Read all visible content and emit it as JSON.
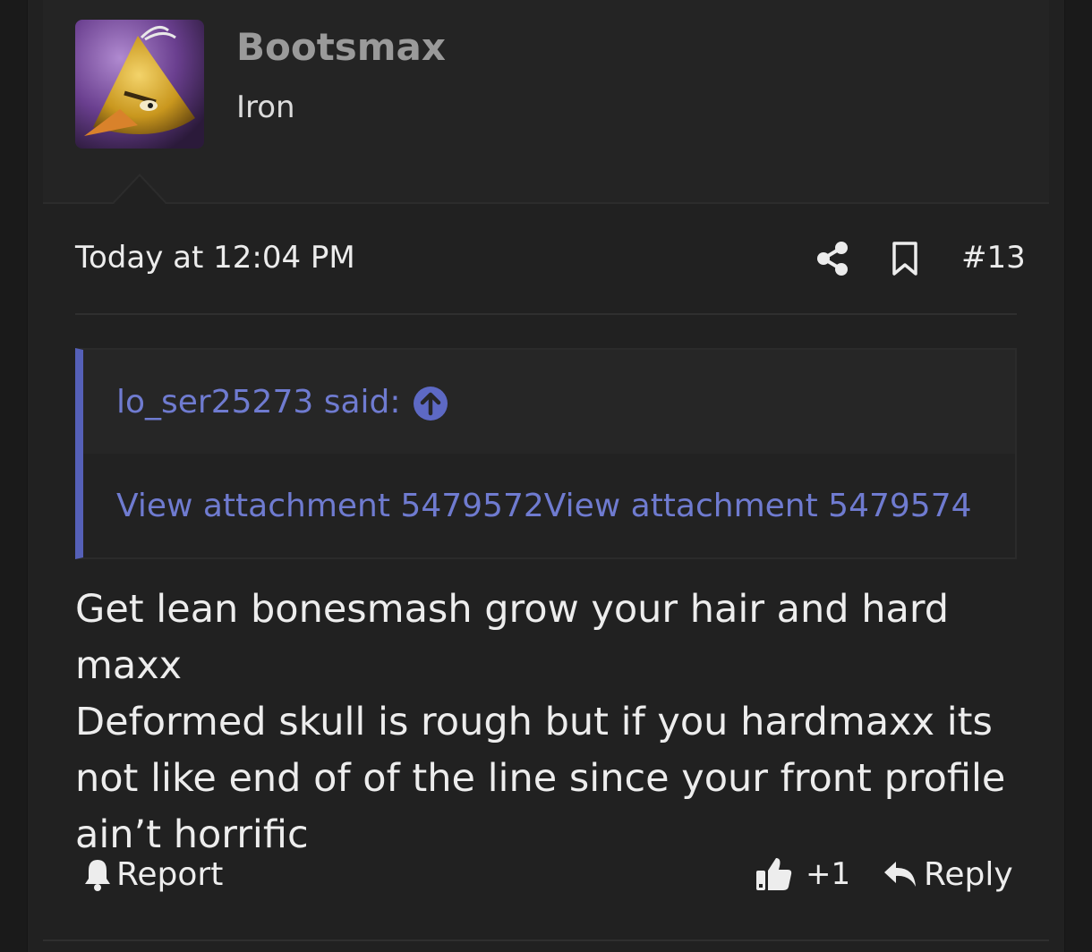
{
  "author": {
    "username": "Bootsmax",
    "title": "Iron"
  },
  "post": {
    "date": "Today at 12:04 PM",
    "number": "#13",
    "body_lines": [
      "Get lean bonesmash grow your hair and hard maxx",
      "Deformed skull is rough but if you hardmaxx its",
      "not like end of of the line since your front profile",
      "ain’t horrific"
    ]
  },
  "quote": {
    "author_said": "lo_ser25273 said:",
    "attachments_text": "View attachment 5479572View attachment 5479574"
  },
  "actions": {
    "report": "Report",
    "like_count": "+1",
    "reply": "Reply"
  },
  "icons": {
    "share": "share-icon",
    "bookmark": "bookmark-icon",
    "quote_up": "arrow-up-circle-icon",
    "report": "bell-icon",
    "like": "thumbs-up-icon",
    "reply": "reply-arrow-icon"
  },
  "colors": {
    "background": "#212121",
    "link": "#6f7bd0",
    "quote_accent": "#5560b8",
    "text": "#ededed"
  }
}
